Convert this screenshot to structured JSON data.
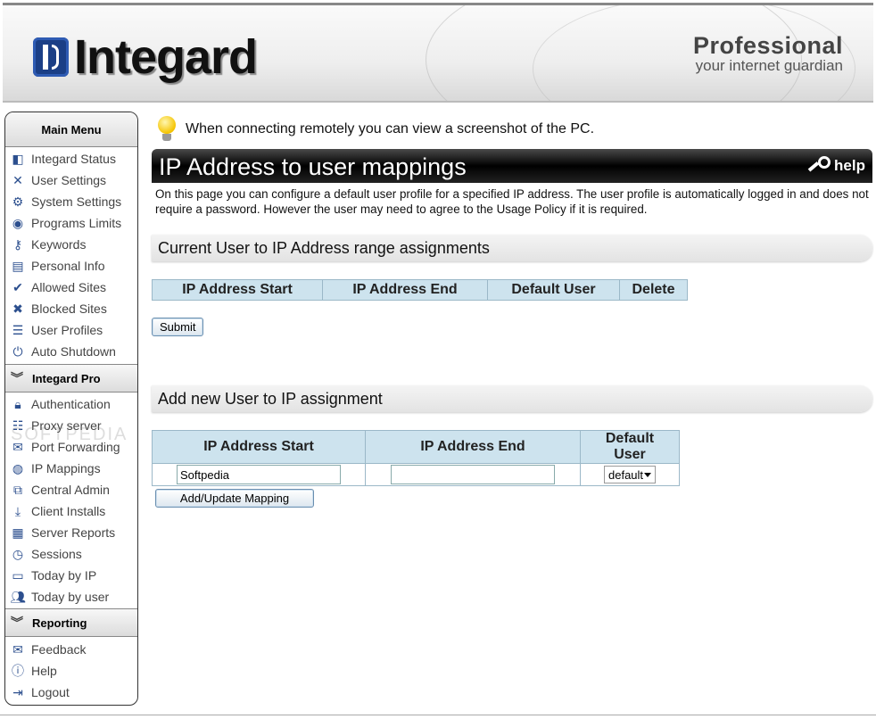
{
  "header": {
    "brand": "Integard",
    "edition": "Professional",
    "tagline": "your internet guardian"
  },
  "sidebar": {
    "main_menu_title": "Main Menu",
    "main_items": [
      {
        "label": "Integard Status",
        "icon": "status-icon"
      },
      {
        "label": "User Settings",
        "icon": "tools-icon"
      },
      {
        "label": "System Settings",
        "icon": "gears-icon"
      },
      {
        "label": "Programs Limits",
        "icon": "cd-icon"
      },
      {
        "label": "Keywords",
        "icon": "key-icon"
      },
      {
        "label": "Personal Info",
        "icon": "id-card-icon"
      },
      {
        "label": "Allowed Sites",
        "icon": "check-icon"
      },
      {
        "label": "Blocked Sites",
        "icon": "x-icon"
      },
      {
        "label": "User Profiles",
        "icon": "profiles-icon"
      },
      {
        "label": "Auto Shutdown",
        "icon": "power-icon"
      }
    ],
    "pro_title": "Integard Pro",
    "pro_items": [
      {
        "label": "Authentication",
        "icon": "lock-icon"
      },
      {
        "label": "Proxy server",
        "icon": "server-icon"
      },
      {
        "label": "Port Forwarding",
        "icon": "forward-mail-icon"
      },
      {
        "label": "IP Mappings",
        "icon": "globe-icon"
      },
      {
        "label": "Central Admin",
        "icon": "network-icon"
      },
      {
        "label": "Client Installs",
        "icon": "download-icon"
      },
      {
        "label": "Server Reports",
        "icon": "report-icon"
      },
      {
        "label": "Sessions",
        "icon": "clock-icon"
      },
      {
        "label": "Today by IP",
        "icon": "monitor-icon"
      },
      {
        "label": "Today by user",
        "icon": "users-icon"
      }
    ],
    "reporting_title": "Reporting",
    "reporting_items": [
      {
        "label": "Feedback",
        "icon": "mail-icon"
      },
      {
        "label": "Help",
        "icon": "info-icon"
      },
      {
        "label": "Logout",
        "icon": "logout-icon"
      }
    ]
  },
  "tip": "When connecting remotely you can view a screenshot of the PC.",
  "page": {
    "title": "IP Address to user mappings",
    "help_label": "help",
    "intro": "On this page you can configure a default user profile for a specified IP address. The user profile is automatically logged in and does not require a password. However the user may need to agree to the Usage Policy if it is required."
  },
  "current": {
    "heading": "Current User to IP Address range assignments",
    "columns": [
      "IP Address Start",
      "IP Address End",
      "Default User",
      "Delete"
    ],
    "submit_label": "Submit"
  },
  "add": {
    "heading": "Add new User to IP assignment",
    "columns": [
      "IP Address Start",
      "IP Address End",
      "Default User"
    ],
    "start_value": "Softpedia",
    "end_value": "",
    "default_user": "default",
    "button_label": "Add/Update Mapping"
  },
  "watermark": "SOFTPEDIA"
}
